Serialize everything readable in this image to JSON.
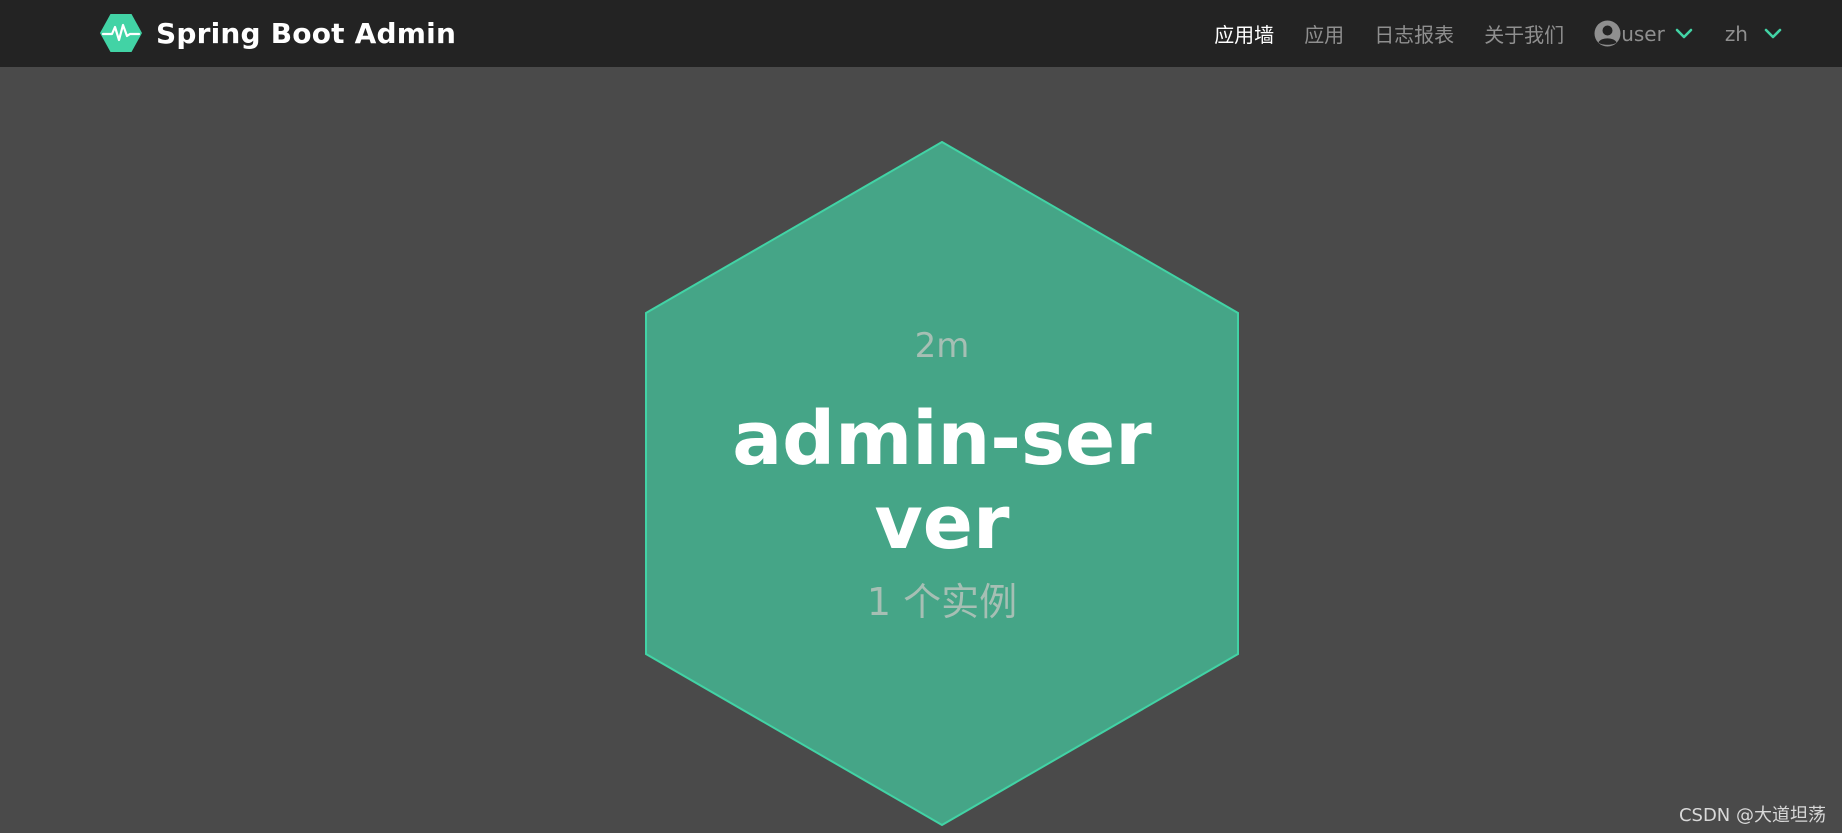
{
  "brand": {
    "title": "Spring Boot Admin",
    "logo_icon": "heartbeat-hexagon-icon",
    "accent": "#42d3a5"
  },
  "nav": {
    "wall_label": "应用墙",
    "applications_label": "应用",
    "journal_label": "日志报表",
    "about_label": "关于我们",
    "user_label": "user",
    "language_label": "zh"
  },
  "applications": [
    {
      "uptime": "2m",
      "name": "admin-server",
      "instances": "1 个实例",
      "status_color": "#45a587"
    }
  ],
  "watermark": "CSDN @大道坦荡"
}
